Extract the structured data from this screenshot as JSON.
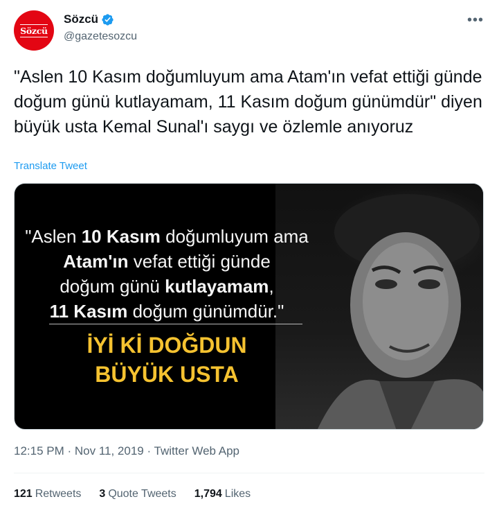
{
  "author": {
    "display_name": "Sözcü",
    "handle": "@gazetesozcu",
    "avatar_text": "Sözcü",
    "verified_icon": "verified-badge-icon"
  },
  "menu_icon": "•••",
  "tweet": {
    "text": "\"Aslen 10 Kasım doğumluyum ama Atam'ın vefat ettiği günde doğum günü kutlayamam, 11 Kasım doğum günümdür\" diyen büyük usta Kemal Sunal'ı saygı ve özlemle anıyoruz",
    "translate_label": "Translate Tweet"
  },
  "media": {
    "quote_lines": [
      [
        "\"Aslen ",
        "10 Kasım",
        " doğumluyum ama"
      ],
      [
        "",
        "Atam'ın",
        " vefat ettiği günde"
      ],
      [
        "doğum günü ",
        "kutlayamam",
        ","
      ],
      [
        "",
        "11 Kasım",
        " doğum günümdür.\""
      ]
    ],
    "headline_line1": "İYİ Kİ DOĞDUN",
    "headline_line2": "BÜYÜK USTA"
  },
  "meta": {
    "timestamp": "12:15 PM · Nov 11, 2019 · Twitter Web App"
  },
  "stats": {
    "retweets_count": "121",
    "retweets_label": "Retweets",
    "quotes_count": "3",
    "quotes_label": "Quote Tweets",
    "likes_count": "1,794",
    "likes_label": "Likes"
  },
  "colors": {
    "brand_red": "#e30613",
    "link_blue": "#1d9bf0",
    "headline_yellow": "#f5c230"
  }
}
